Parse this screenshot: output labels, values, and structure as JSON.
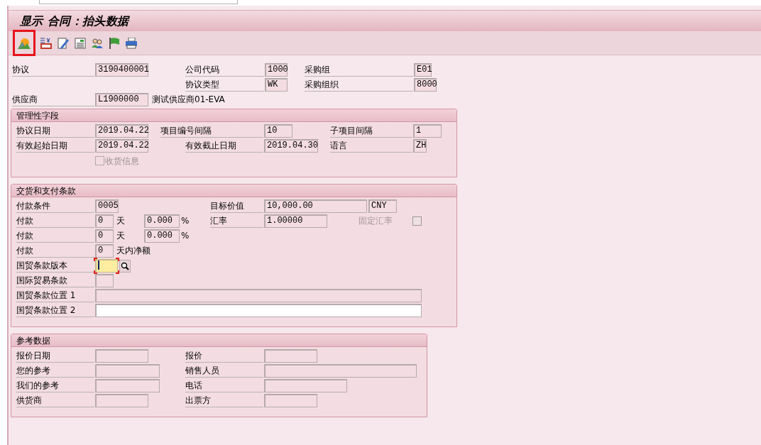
{
  "title": "显示 合同：抬头数据",
  "toolbar": [
    {
      "kind": "sun",
      "highlighted": true
    },
    {
      "kind": "money",
      "highlighted": false
    },
    {
      "kind": "edit",
      "highlighted": false
    },
    {
      "kind": "doc",
      "highlighted": false
    },
    {
      "kind": "people",
      "highlighted": false
    },
    {
      "kind": "flag",
      "highlighted": false
    },
    {
      "kind": "print",
      "highlighted": false
    }
  ],
  "header": [
    [
      {
        "kind": "label",
        "text": "协议"
      },
      {
        "kind": "field",
        "value": "3190400001"
      },
      {
        "kind": "label",
        "text": "公司代码"
      },
      {
        "kind": "field",
        "value": "1000"
      },
      {
        "kind": "label",
        "text": "采购组"
      },
      {
        "kind": "field",
        "value": "E01"
      }
    ],
    [
      {
        "kind": "label",
        "text": "协议类型"
      },
      {
        "kind": "field",
        "value": "WK"
      },
      {
        "kind": "label",
        "text": "采购组织"
      },
      {
        "kind": "field",
        "value": "8000"
      }
    ],
    [
      {
        "kind": "label",
        "text": "供应商"
      },
      {
        "kind": "field",
        "value": "L1900000"
      },
      {
        "kind": "text",
        "text": "测试供应商01-EVA"
      }
    ]
  ],
  "sections": [
    {
      "title": "管理性字段",
      "rows": [
        [
          {
            "kind": "label",
            "text": "协议日期"
          },
          {
            "kind": "field",
            "value": "2019.04.22"
          },
          {
            "kind": "label",
            "text": "项目编号间隔"
          },
          {
            "kind": "field",
            "value": "10"
          },
          {
            "kind": "label",
            "text": "子项目间隔"
          },
          {
            "kind": "field",
            "value": "1"
          }
        ],
        [
          {
            "kind": "label",
            "text": "有效起始日期"
          },
          {
            "kind": "field",
            "value": "2019.04.22"
          },
          {
            "kind": "label",
            "text": "有效截止日期"
          },
          {
            "kind": "field",
            "value": "2019.04.30"
          },
          {
            "kind": "label",
            "text": "语言"
          },
          {
            "kind": "field",
            "value": "ZH"
          }
        ],
        [
          "",
          {
            "kind": "checkbox",
            "text": "收货信息",
            "checked": false,
            "disabled": true
          }
        ]
      ]
    },
    {
      "title": "交货和支付条款",
      "rows": [
        [
          {
            "kind": "label",
            "text": "付款条件"
          },
          {
            "kind": "field",
            "value": "0005"
          },
          "",
          "",
          "",
          {
            "kind": "label",
            "text": "目标价值"
          },
          {
            "kind": "field",
            "value": "10,000.00"
          },
          {
            "kind": "field",
            "value": "CNY"
          }
        ],
        [
          {
            "kind": "label",
            "text": "付款"
          },
          {
            "kind": "field",
            "value": "0"
          },
          {
            "kind": "text",
            "text": "天"
          },
          {
            "kind": "field",
            "value": "0.000"
          },
          {
            "kind": "text",
            "text": "%"
          },
          {
            "kind": "label",
            "text": "汇率"
          },
          {
            "kind": "field",
            "value": "1.00000"
          },
          {
            "kind": "label",
            "text": "固定汇率",
            "disabled": true
          },
          {
            "kind": "checkbox",
            "checked": false,
            "disabled": false
          }
        ],
        [
          {
            "kind": "label",
            "text": "付款"
          },
          {
            "kind": "field",
            "value": "0"
          },
          {
            "kind": "text",
            "text": "天"
          },
          {
            "kind": "field",
            "value": "0.000"
          },
          {
            "kind": "text",
            "text": "%"
          }
        ],
        [
          {
            "kind": "label",
            "text": "付款"
          },
          {
            "kind": "field",
            "value": "0"
          },
          {
            "kind": "text",
            "text": "天内净额"
          }
        ],
        [
          {
            "kind": "label",
            "text": "国贸条款版本"
          },
          {
            "kind": "field",
            "focused": true
          },
          {
            "kind": "search"
          }
        ],
        [
          {
            "kind": "label",
            "text": "国际贸易条款"
          },
          {
            "kind": "field"
          }
        ],
        [
          {
            "kind": "label",
            "text": "国贸条款位置 1"
          },
          {
            "kind": "field"
          }
        ],
        [
          {
            "kind": "label",
            "text": "国贸条款位置 2"
          },
          {
            "kind": "field",
            "editable": true
          }
        ]
      ]
    },
    {
      "title": "参考数据",
      "rows": [
        [
          {
            "kind": "label",
            "text": "报价日期"
          },
          {
            "kind": "field"
          },
          {
            "kind": "label",
            "text": "报价"
          },
          {
            "kind": "field"
          }
        ],
        [
          {
            "kind": "label",
            "text": "您的参考"
          },
          {
            "kind": "field"
          },
          {
            "kind": "label",
            "text": "销售人员"
          },
          {
            "kind": "field"
          }
        ],
        [
          {
            "kind": "label",
            "text": "我们的参考"
          },
          {
            "kind": "field"
          },
          {
            "kind": "label",
            "text": "电话"
          },
          {
            "kind": "field"
          }
        ],
        [
          {
            "kind": "label",
            "text": "供货商"
          },
          {
            "kind": "field"
          },
          {
            "kind": "label",
            "text": "出票方"
          },
          {
            "kind": "field"
          }
        ]
      ]
    }
  ]
}
